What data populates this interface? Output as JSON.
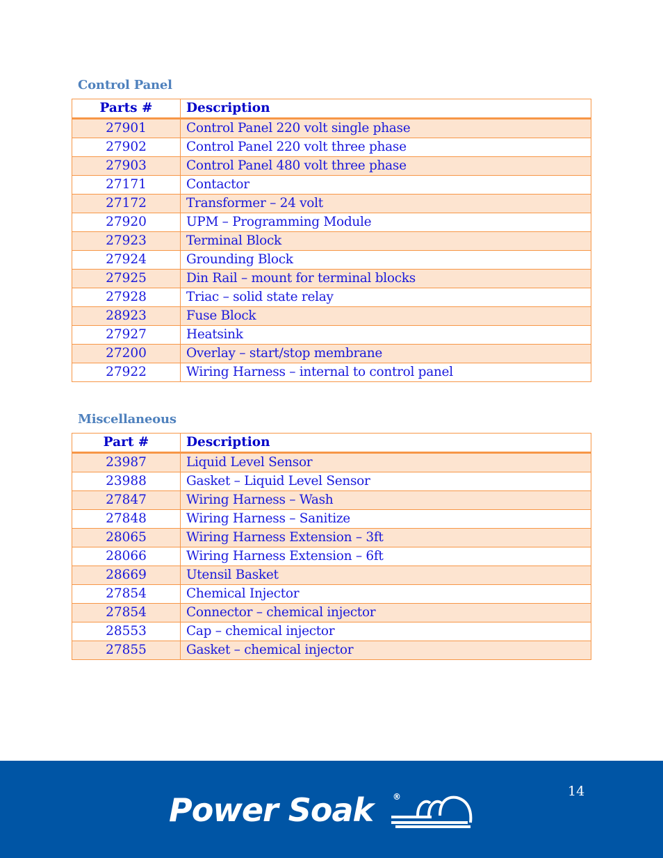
{
  "sections": [
    {
      "title": "Control Panel",
      "headers": {
        "part": "Parts #",
        "description": "Description"
      },
      "rows": [
        {
          "part": "27901",
          "description": "Control Panel 220 volt single phase"
        },
        {
          "part": "27902",
          "description": "Control Panel 220 volt three phase"
        },
        {
          "part": "27903",
          "description": "Control Panel 480 volt three phase"
        },
        {
          "part": "27171",
          "description": "Contactor"
        },
        {
          "part": "27172",
          "description": "Transformer – 24 volt"
        },
        {
          "part": "27920",
          "description": "UPM – Programming Module"
        },
        {
          "part": "27923",
          "description": "Terminal Block"
        },
        {
          "part": "27924",
          "description": "Grounding Block"
        },
        {
          "part": "27925",
          "description": "Din Rail – mount for terminal blocks"
        },
        {
          "part": "27928",
          "description": "Triac – solid state relay"
        },
        {
          "part": "28923",
          "description": "Fuse Block"
        },
        {
          "part": "27927",
          "description": "Heatsink"
        },
        {
          "part": "27200",
          "description": "Overlay – start/stop membrane"
        },
        {
          "part": "27922",
          "description": "Wiring Harness – internal to control panel"
        }
      ]
    },
    {
      "title": "Miscellaneous",
      "headers": {
        "part": "Part #",
        "description": "Description"
      },
      "rows": [
        {
          "part": "23987",
          "description": "Liquid Level Sensor"
        },
        {
          "part": "23988",
          "description": "Gasket – Liquid Level Sensor"
        },
        {
          "part": "27847",
          "description": "Wiring Harness – Wash"
        },
        {
          "part": "27848",
          "description": "Wiring Harness – Sanitize"
        },
        {
          "part": "28065",
          "description": "Wiring Harness Extension – 3ft"
        },
        {
          "part": "28066",
          "description": "Wiring Harness Extension – 6ft"
        },
        {
          "part": "28669",
          "description": "Utensil Basket"
        },
        {
          "part": "27854",
          "description": "Chemical Injector"
        },
        {
          "part": "27854",
          "description": "Connector – chemical injector"
        },
        {
          "part": "28553",
          "description": "Cap – chemical injector"
        },
        {
          "part": "27855",
          "description": "Gasket – chemical injector"
        }
      ]
    }
  ],
  "footer": {
    "page_number": "14",
    "brand": "Power Soak",
    "registered_mark": "®",
    "background_color": "#0055a5"
  },
  "colors": {
    "section_title": "#4f81bd",
    "table_text": "#1a1adc",
    "table_border": "#f79646",
    "row_shade": "#fde4d0"
  }
}
